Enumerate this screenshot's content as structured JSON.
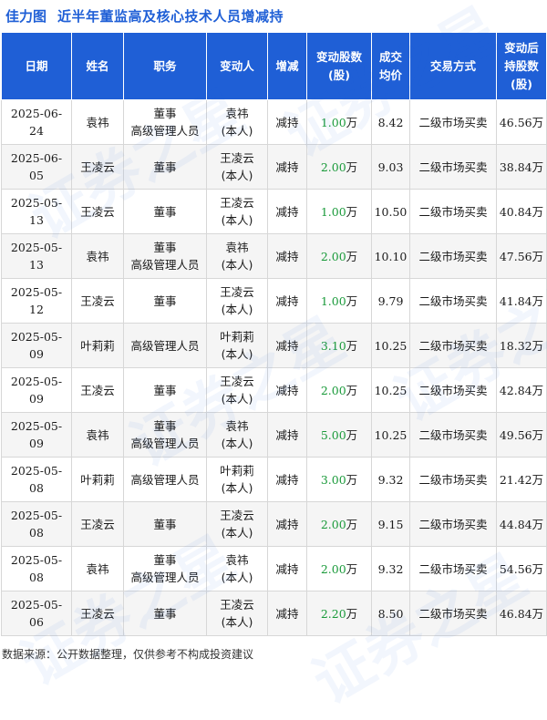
{
  "brand": "佳力图",
  "title": "近半年董监高及核心技术人员增减持",
  "watermark": "证券之星",
  "columns": [
    "日期",
    "姓名",
    "职务",
    "变动人",
    "增减",
    "变动股数\n(股)",
    "成交\n均价",
    "交易方式",
    "变动后\n持股数\n(股)"
  ],
  "rows": [
    {
      "date": "2025-06-24",
      "name": "袁祎",
      "position": "董事\n高级管理人员",
      "changer": "袁祎\n(本人)",
      "change": "减持",
      "shares": "1.00",
      "unit": "万",
      "price": "8.42",
      "method": "二级市场买卖",
      "after": "46.56万"
    },
    {
      "date": "2025-06-05",
      "name": "王凌云",
      "position": "董事",
      "changer": "王凌云\n(本人)",
      "change": "减持",
      "shares": "2.00",
      "unit": "万",
      "price": "9.03",
      "method": "二级市场买卖",
      "after": "38.84万"
    },
    {
      "date": "2025-05-13",
      "name": "王凌云",
      "position": "董事",
      "changer": "王凌云\n(本人)",
      "change": "减持",
      "shares": "1.00",
      "unit": "万",
      "price": "10.50",
      "method": "二级市场买卖",
      "after": "40.84万"
    },
    {
      "date": "2025-05-13",
      "name": "袁祎",
      "position": "董事\n高级管理人员",
      "changer": "袁祎\n(本人)",
      "change": "减持",
      "shares": "2.00",
      "unit": "万",
      "price": "10.10",
      "method": "二级市场买卖",
      "after": "47.56万"
    },
    {
      "date": "2025-05-12",
      "name": "王凌云",
      "position": "董事",
      "changer": "王凌云\n(本人)",
      "change": "减持",
      "shares": "1.00",
      "unit": "万",
      "price": "9.79",
      "method": "二级市场买卖",
      "after": "41.84万"
    },
    {
      "date": "2025-05-09",
      "name": "叶莉莉",
      "position": "高级管理人员",
      "changer": "叶莉莉\n(本人)",
      "change": "减持",
      "shares": "3.10",
      "unit": "万",
      "price": "10.25",
      "method": "二级市场买卖",
      "after": "18.32万"
    },
    {
      "date": "2025-05-09",
      "name": "王凌云",
      "position": "董事",
      "changer": "王凌云\n(本人)",
      "change": "减持",
      "shares": "2.00",
      "unit": "万",
      "price": "10.25",
      "method": "二级市场买卖",
      "after": "42.84万"
    },
    {
      "date": "2025-05-09",
      "name": "袁祎",
      "position": "董事\n高级管理人员",
      "changer": "袁祎\n(本人)",
      "change": "减持",
      "shares": "5.00",
      "unit": "万",
      "price": "10.25",
      "method": "二级市场买卖",
      "after": "49.56万"
    },
    {
      "date": "2025-05-08",
      "name": "叶莉莉",
      "position": "高级管理人员",
      "changer": "叶莉莉\n(本人)",
      "change": "减持",
      "shares": "3.00",
      "unit": "万",
      "price": "9.32",
      "method": "二级市场买卖",
      "after": "21.42万"
    },
    {
      "date": "2025-05-08",
      "name": "王凌云",
      "position": "董事",
      "changer": "王凌云\n(本人)",
      "change": "减持",
      "shares": "2.00",
      "unit": "万",
      "price": "9.15",
      "method": "二级市场买卖",
      "after": "44.84万"
    },
    {
      "date": "2025-05-08",
      "name": "袁祎",
      "position": "董事\n高级管理人员",
      "changer": "袁祎\n(本人)",
      "change": "减持",
      "shares": "2.00",
      "unit": "万",
      "price": "9.32",
      "method": "二级市场买卖",
      "after": "54.56万"
    },
    {
      "date": "2025-05-06",
      "name": "王凌云",
      "position": "董事",
      "changer": "王凌云\n(本人)",
      "change": "减持",
      "shares": "2.20",
      "unit": "万",
      "price": "8.50",
      "method": "二级市场买卖",
      "after": "46.84万"
    }
  ],
  "footer": "数据来源：公开数据整理，仅供参考不构成投资建议",
  "colors": {
    "header_bg": "#1f5fd6",
    "brand": "#1f5fd6",
    "decrease": "#1a9a3a",
    "row_alt": "#f5f5f5"
  }
}
